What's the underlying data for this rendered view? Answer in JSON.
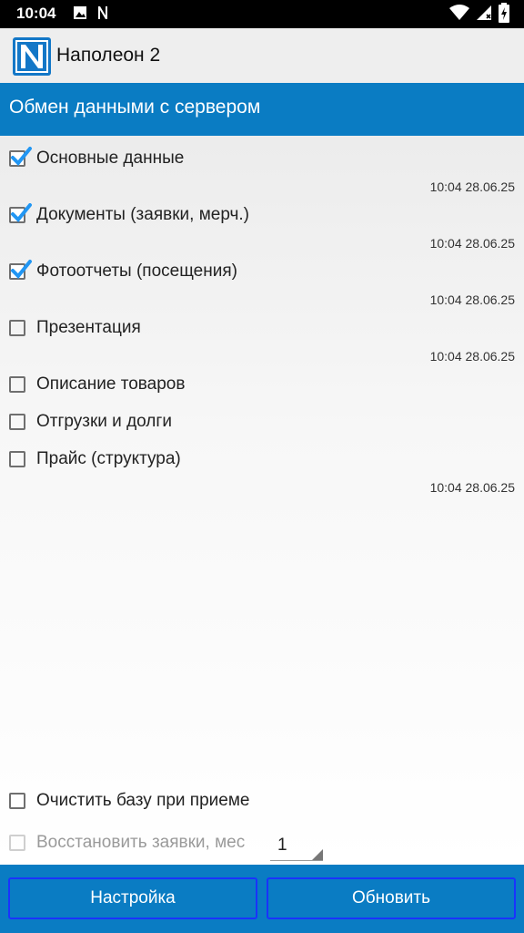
{
  "status_bar": {
    "time": "10:04",
    "icons": [
      "image-icon",
      "n-notification-icon",
      "wifi-icon",
      "signal-icon",
      "battery-charging-icon"
    ]
  },
  "app_bar": {
    "title": "Наполеон 2",
    "logo_letter": "N",
    "logo_color": "#1377c7"
  },
  "header": {
    "title": "Обмен данными с сервером",
    "color": "#0a7cc3"
  },
  "sync_items": [
    {
      "label": "Основные данные",
      "checked": true,
      "timestamp": "10:04 28.06.25"
    },
    {
      "label": "Документы (заявки, мерч.)",
      "checked": true,
      "timestamp": "10:04 28.06.25"
    },
    {
      "label": "Фотоотчеты (посещения)",
      "checked": true,
      "timestamp": "10:04 28.06.25"
    },
    {
      "label": "Презентация",
      "checked": false,
      "timestamp": "10:04 28.06.25"
    },
    {
      "label": "Описание товаров",
      "checked": false,
      "timestamp": ""
    },
    {
      "label": "Отгрузки и долги",
      "checked": false,
      "timestamp": ""
    },
    {
      "label": "Прайс (структура)",
      "checked": false,
      "timestamp": "10:04 28.06.25"
    }
  ],
  "options": {
    "clear_db": {
      "label": "Очистить базу при приеме",
      "checked": false
    },
    "restore_orders": {
      "label": "Восстановить заявки, мес",
      "checked": false,
      "disabled": true,
      "months_value": "1"
    }
  },
  "buttons": {
    "settings": "Настройка",
    "update": "Обновить"
  },
  "colors": {
    "accent": "#0a7cc3",
    "check_blue": "#2196f3",
    "button_border": "#1a33ff"
  }
}
